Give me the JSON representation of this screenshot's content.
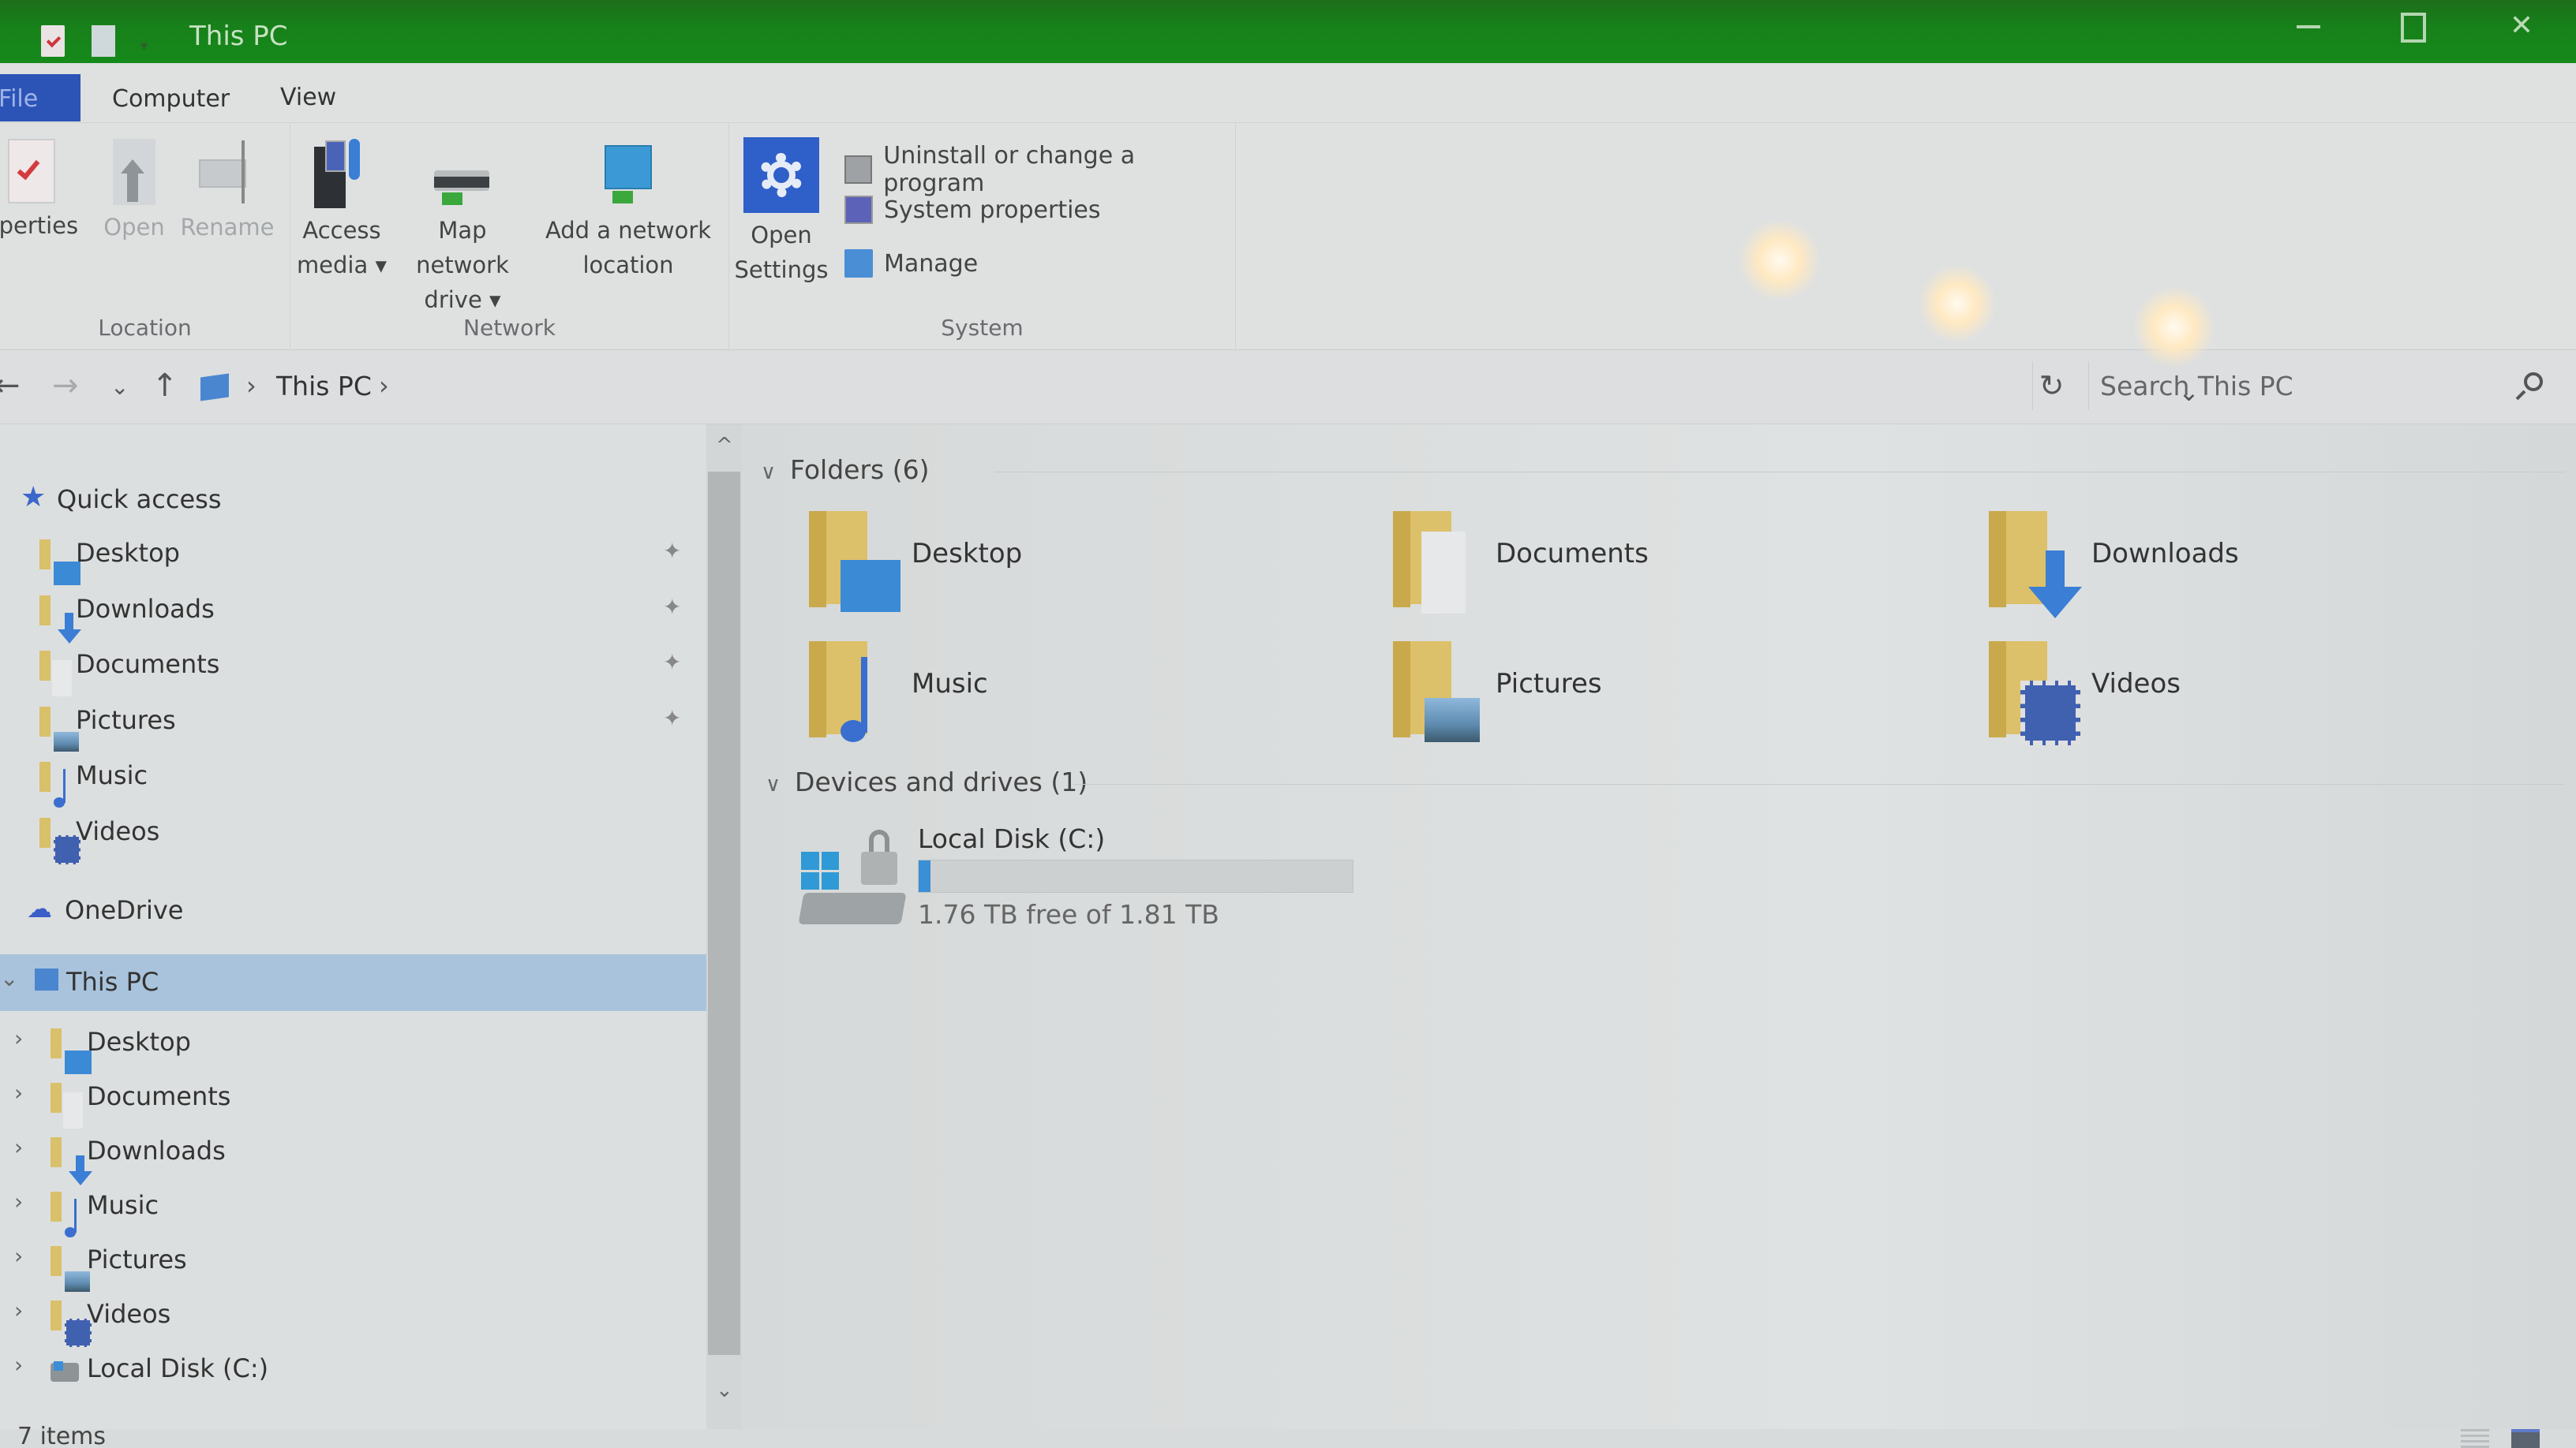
{
  "window": {
    "title": "This PC",
    "controls": {
      "minimize": "minimize",
      "maximize": "maximize",
      "close": "✕"
    }
  },
  "ribbon_tabs": [
    {
      "label": "File",
      "active": true
    },
    {
      "label": "Computer"
    },
    {
      "label": "View"
    }
  ],
  "ribbon": {
    "groups": {
      "location": {
        "label": "Location",
        "buttons": [
          {
            "label": "operties",
            "icon": "properties-icon"
          },
          {
            "label": "Open",
            "icon": "open-icon",
            "disabled": true
          },
          {
            "label": "Rename",
            "icon": "rename-icon",
            "disabled": true
          }
        ]
      },
      "network": {
        "label": "Network",
        "buttons": [
          {
            "label_line1": "Access",
            "label_line2": "media ▾",
            "icon": "access-media-icon"
          },
          {
            "label_line1": "Map network",
            "label_line2": "drive ▾",
            "icon": "map-network-drive-icon"
          },
          {
            "label_line1": "Add a network",
            "label_line2": "location",
            "icon": "add-network-location-icon"
          }
        ]
      },
      "system": {
        "label": "System",
        "open_settings": {
          "label_line1": "Open",
          "label_line2": "Settings",
          "icon": "settings-gear-icon"
        },
        "small_buttons": [
          {
            "label": "Uninstall or change a program",
            "icon": "uninstall-program-icon"
          },
          {
            "label": "System properties",
            "icon": "system-properties-icon"
          },
          {
            "label": "Manage",
            "icon": "manage-computer-icon"
          }
        ]
      }
    },
    "collapse_glyph": "^",
    "help_glyph": "?"
  },
  "address_bar": {
    "back": "←",
    "forward": "→",
    "recent": "⌄",
    "up": "↑",
    "separator": "›",
    "crumb": "This PC",
    "dropdown": "⌄",
    "refresh": "↻",
    "search_placeholder": "Search This PC",
    "search_value": ""
  },
  "nav_pane": {
    "quick_access": {
      "label": "Quick access",
      "items": [
        {
          "label": "Desktop",
          "pinned": true,
          "icon": "desktop-folder-icon"
        },
        {
          "label": "Downloads",
          "pinned": true,
          "icon": "downloads-folder-icon"
        },
        {
          "label": "Documents",
          "pinned": true,
          "icon": "documents-folder-icon"
        },
        {
          "label": "Pictures",
          "pinned": true,
          "icon": "pictures-folder-icon"
        },
        {
          "label": "Music",
          "pinned": false,
          "icon": "music-folder-icon"
        },
        {
          "label": "Videos",
          "pinned": false,
          "icon": "videos-folder-icon"
        }
      ]
    },
    "onedrive": {
      "label": "OneDrive"
    },
    "this_pc": {
      "label": "This PC",
      "selected": true,
      "children": [
        {
          "label": "Desktop",
          "icon": "desktop-folder-icon"
        },
        {
          "label": "Documents",
          "icon": "documents-folder-icon"
        },
        {
          "label": "Downloads",
          "icon": "downloads-folder-icon"
        },
        {
          "label": "Music",
          "icon": "music-folder-icon"
        },
        {
          "label": "Pictures",
          "icon": "pictures-folder-icon"
        },
        {
          "label": "Videos",
          "icon": "videos-folder-icon"
        },
        {
          "label": "Local Disk (C:)",
          "icon": "local-disk-icon"
        }
      ]
    },
    "pin_glyph": "📌",
    "chevron_right": "›",
    "chevron_down": "⌄"
  },
  "content": {
    "folders_header": "Folders (6)",
    "folders": [
      {
        "label": "Desktop",
        "overlay": "desktop"
      },
      {
        "label": "Documents",
        "overlay": "documents"
      },
      {
        "label": "Downloads",
        "overlay": "downloads"
      },
      {
        "label": "Music",
        "overlay": "music"
      },
      {
        "label": "Pictures",
        "overlay": "pictures"
      },
      {
        "label": "Videos",
        "overlay": "videos"
      }
    ],
    "devices_header": "Devices and drives (1)",
    "drives": [
      {
        "label": "Local Disk (C:)",
        "free_text": "1.76 TB free of 1.81 TB",
        "free_tb": 1.76,
        "total_tb": 1.81,
        "used_fraction": 0.028
      }
    ]
  },
  "status_bar": {
    "item_count": "7 items"
  },
  "colors": {
    "titlebar": "#17801a",
    "file_tab": "#2c54b7",
    "selection": "#a9c3dc",
    "drive_bar_fill": "#3b8fd6",
    "folder_yellow": "#dcc06a"
  }
}
